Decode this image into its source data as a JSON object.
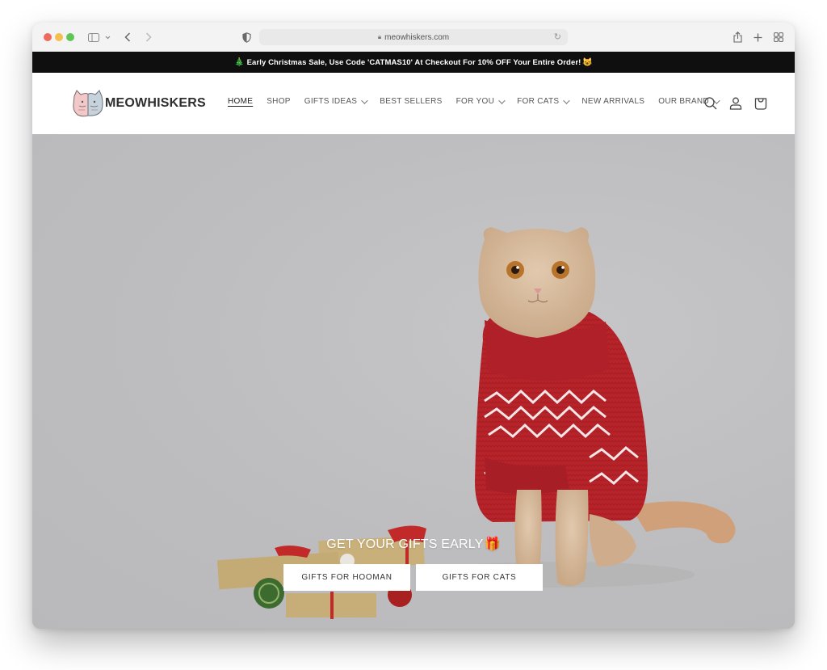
{
  "browser": {
    "url": "meowhiskers.com",
    "icons": [
      "sidebar-icon",
      "chevron-down-icon",
      "back-icon",
      "forward-icon",
      "privacy-shield-icon",
      "lock-icon",
      "reload-icon",
      "share-icon",
      "new-tab-icon",
      "tab-overview-icon"
    ]
  },
  "announcement": {
    "leading_emoji": "🎄",
    "text": "Early Christmas Sale, Use Code 'CATMAS10' At Checkout For 10% OFF Your Entire Order!",
    "trailing_emoji": "😺"
  },
  "header": {
    "logo_text": "MEOWHISKERS",
    "nav": [
      {
        "label": "HOME",
        "active": true,
        "dropdown": false
      },
      {
        "label": "SHOP",
        "active": false,
        "dropdown": false
      },
      {
        "label": "GIFTS IDEAS",
        "active": false,
        "dropdown": true
      },
      {
        "label": "BEST SELLERS",
        "active": false,
        "dropdown": false
      },
      {
        "label": "FOR YOU",
        "active": false,
        "dropdown": true
      },
      {
        "label": "FOR CATS",
        "active": false,
        "dropdown": true
      },
      {
        "label": "NEW ARRIVALS",
        "active": false,
        "dropdown": false
      },
      {
        "label": "OUR BRAND",
        "active": false,
        "dropdown": true
      }
    ],
    "icons": [
      "search-icon",
      "account-icon",
      "cart-icon"
    ]
  },
  "hero": {
    "title": "GET YOUR GIFTS EARLY",
    "title_emoji": "🎁",
    "buttons": [
      {
        "label": "GIFTS FOR HOOMAN"
      },
      {
        "label": "GIFTS FOR CATS"
      }
    ],
    "image_description": "Scottish fold cat wearing a red knitted sweater beside wrapped gifts with red ribbons and a green ornament"
  },
  "colors": {
    "announcement_bg": "#0f0f0f",
    "hero_bg": "#bdbdbf",
    "sweater_red": "#b8232a",
    "text_dark": "#2e2e2e"
  }
}
